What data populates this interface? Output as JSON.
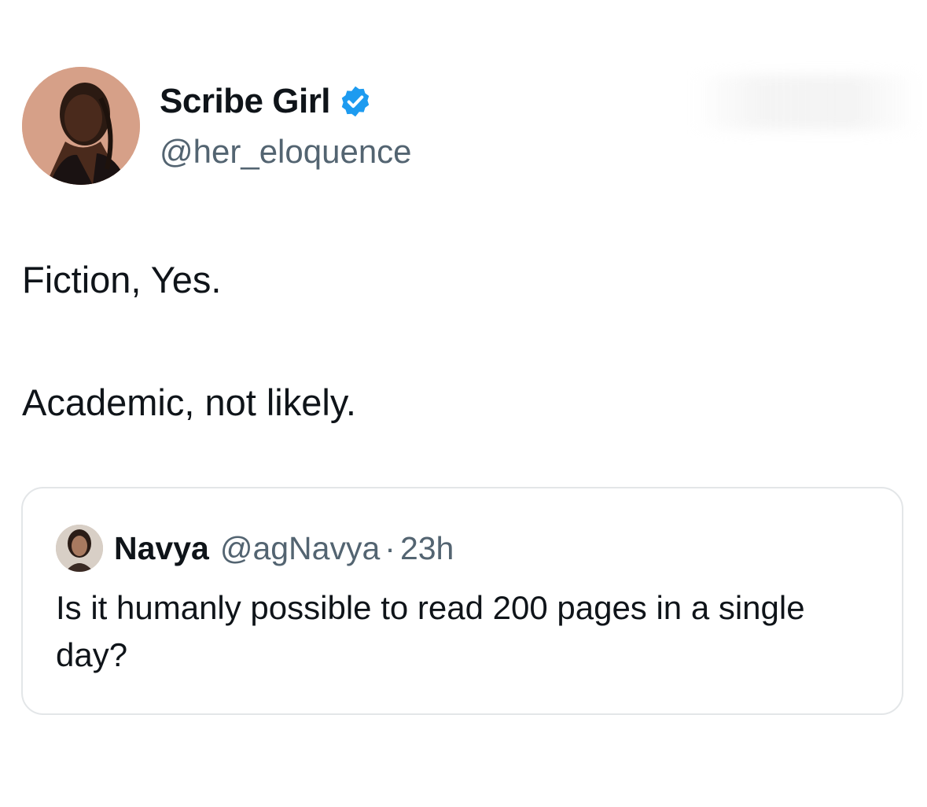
{
  "author": {
    "display_name": "Scribe Girl",
    "handle": "@her_eloquence",
    "verified": true,
    "verified_color": "#1d9bf0"
  },
  "tweet": {
    "line1": "Fiction, Yes.",
    "line2": "Academic, not likely."
  },
  "quoted_tweet": {
    "display_name": "Navya",
    "handle": "@agNavya",
    "separator": "·",
    "time": "23h",
    "text": "Is it humanly possible to read 200 pages in a single day?"
  },
  "colors": {
    "text_primary": "#0f1419",
    "text_secondary": "#536471",
    "border": "#e3e6e8"
  }
}
